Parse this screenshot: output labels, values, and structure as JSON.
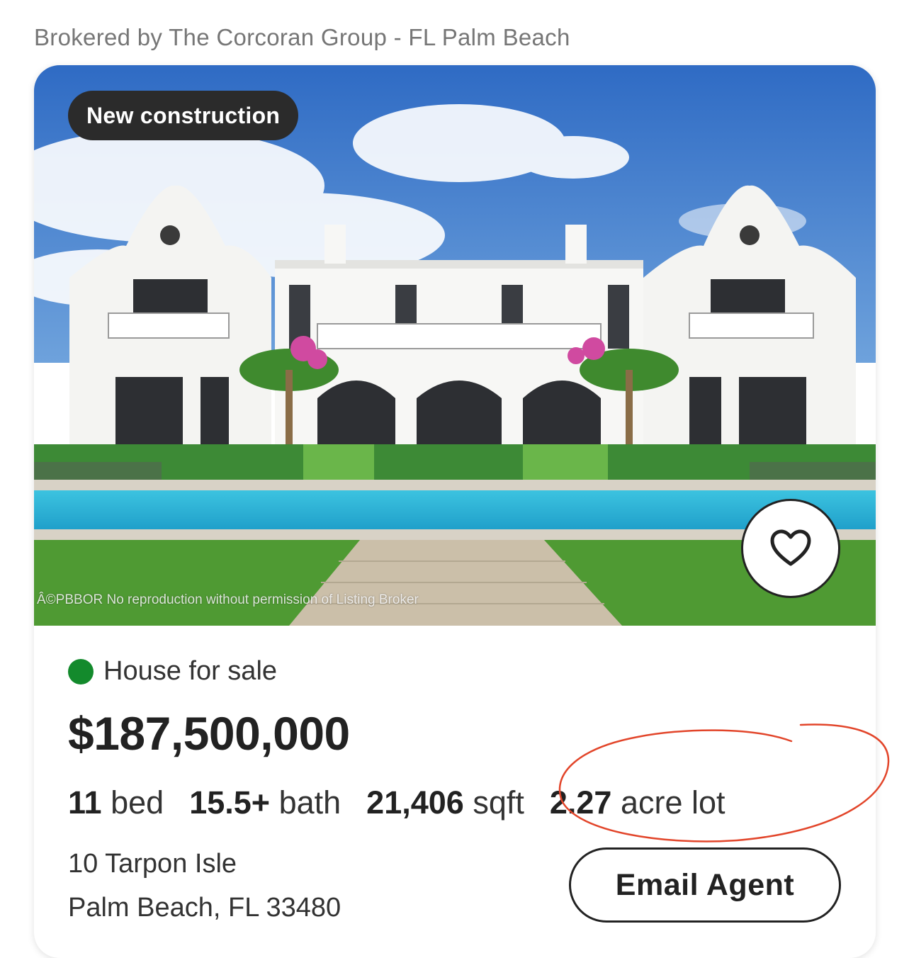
{
  "broker_line": "Brokered by The Corcoran Group - FL Palm Beach",
  "listing": {
    "badge": "New construction",
    "photo_watermark": "Â©PBBOR No reproduction without permission of Listing Broker",
    "status": "House for sale",
    "status_color": "#138a2c",
    "price": "$187,500,000",
    "specs": {
      "beds_value": "11",
      "beds_unit": "bed",
      "baths_value": "15.5+",
      "baths_unit": "bath",
      "sqft_value": "21,406",
      "sqft_unit": "sqft",
      "lot_value": "2.27",
      "lot_unit": "acre lot"
    },
    "address_line1": "10 Tarpon Isle",
    "address_line2": "Palm Beach, FL 33480",
    "email_button": "Email Agent",
    "favorite_icon": "heart-icon"
  },
  "annotation_color": "#e2452a"
}
